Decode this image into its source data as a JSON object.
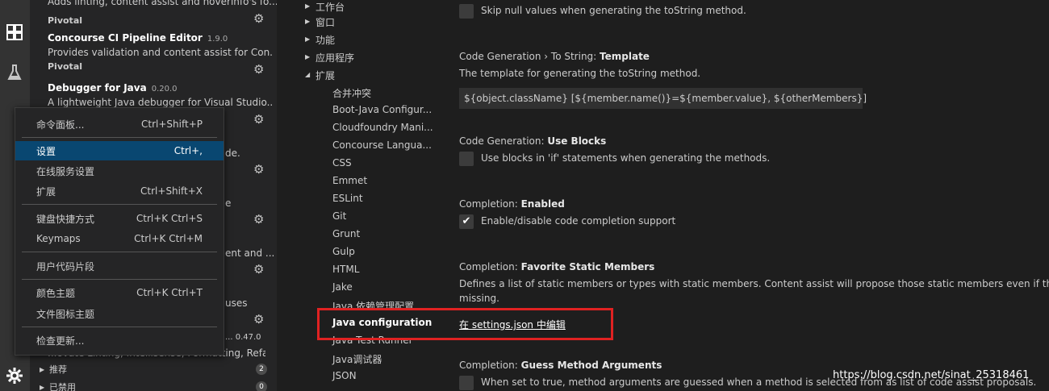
{
  "sidebar": {
    "partial_top_text": "Adds linting, content assist and hoverinfo's fo...",
    "ext1": {
      "publisher": "Pivotal"
    },
    "ext2": {
      "title": "Concourse CI Pipeline Editor",
      "version": "1.9.0",
      "description": "Provides validation and content assist for Con...",
      "publisher": "Pivotal"
    },
    "ext3": {
      "title": "Debugger for Java",
      "version": "0.20.0",
      "description": "A lightweight Java debugger for Visual Studio..."
    },
    "fragments": {
      "f1": "de.",
      "f2": "e",
      "f3": "ent and ...",
      "f4": "uses",
      "f5": "... 0.47.0",
      "f6": "...ovate Linting, Intellisense, Formatting, Refactori..."
    },
    "sections": [
      {
        "label": "推荐",
        "count": "2"
      },
      {
        "label": "已禁用",
        "count": "0"
      }
    ]
  },
  "menu": {
    "items": [
      {
        "label": "命令面板...",
        "key": "Ctrl+Shift+P"
      },
      {
        "label": "设置",
        "key": "Ctrl+,"
      },
      {
        "label": "在线服务设置",
        "key": ""
      },
      {
        "label": "扩展",
        "key": "Ctrl+Shift+X"
      },
      {
        "label": "键盘快捷方式",
        "key": "Ctrl+K Ctrl+S"
      },
      {
        "label": "Keymaps",
        "key": "Ctrl+K Ctrl+M"
      },
      {
        "label": "用户代码片段",
        "key": ""
      },
      {
        "label": "颜色主题",
        "key": "Ctrl+K Ctrl+T"
      },
      {
        "label": "文件图标主题",
        "key": ""
      },
      {
        "label": "检查更新...",
        "key": ""
      }
    ]
  },
  "toc": {
    "top": [
      "工作台",
      "窗口",
      "功能",
      "应用程序",
      "扩展"
    ],
    "sub": [
      "合并冲突",
      "Boot-Java Configur...",
      "Cloudfoundry Mani...",
      "Concourse Langua...",
      "CSS",
      "Emmet",
      "ESLint",
      "Git",
      "Grunt",
      "Gulp",
      "HTML",
      "Jake",
      "Java 依赖管理配置",
      "Java configuration",
      "Java Test Runner",
      "Java调试器",
      "JSON"
    ]
  },
  "settings": {
    "skip_null": {
      "label": "Skip null values when generating the toString method."
    },
    "template": {
      "category": "Code Generation › To String: ",
      "name": "Template",
      "description": "The template for generating the toString method.",
      "value": "${object.className} [${member.name()}=${member.value}, ${otherMembers}]"
    },
    "use_blocks": {
      "category": "Code Generation: ",
      "name": "Use Blocks",
      "label": "Use blocks in 'if' statements when generating the methods."
    },
    "completion_enabled": {
      "category": "Completion: ",
      "name": "Enabled",
      "label": "Enable/disable code completion support",
      "checked": true
    },
    "favorite_static": {
      "category": "Completion: ",
      "name": "Favorite Static Members",
      "description_line1": "Defines a list of static members or types with static members. Content assist will propose those static members even if the impo",
      "description_line2": "missing.",
      "link": "在 settings.json 中编辑"
    },
    "guess_args": {
      "category": "Completion: ",
      "name": "Guess Method Arguments",
      "label": "When set to true, method arguments are guessed when a method is selected from as list of code assist proposals."
    }
  },
  "watermark": "https://blog.csdn.net/sinat_25318461",
  "colors": {
    "menu_selection": "#094771",
    "highlight_box": "#e02222"
  }
}
